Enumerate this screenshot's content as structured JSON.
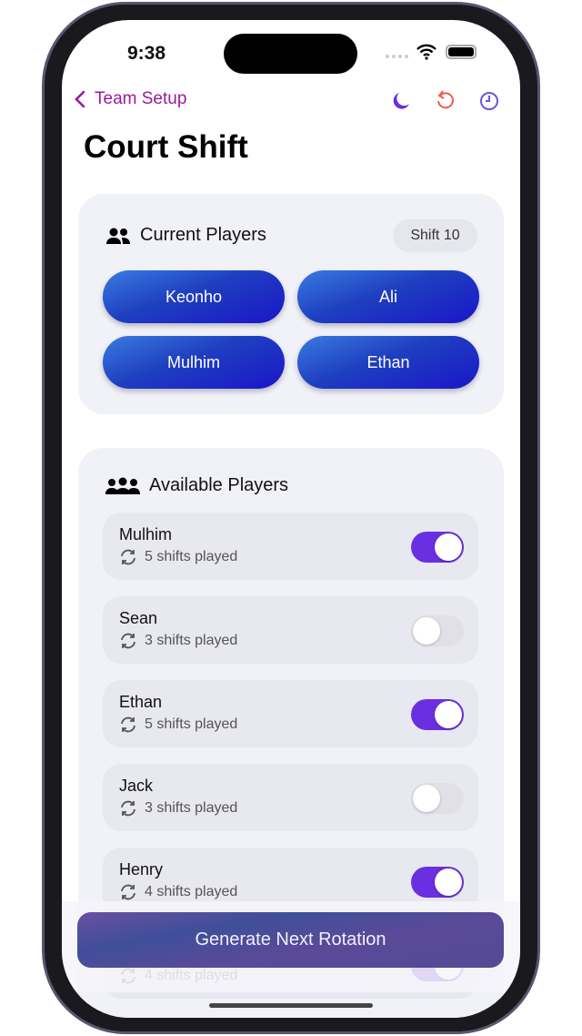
{
  "status": {
    "time": "9:38"
  },
  "nav": {
    "back_label": "Team Setup",
    "icons": [
      "moon-icon",
      "reset-icon",
      "history-icon"
    ],
    "colors": {
      "back": "#9b1a9b",
      "moon": "#6a2fe0",
      "reset": "#f25c4a",
      "history": "#6a55e0"
    }
  },
  "title": "Court Shift",
  "current": {
    "title": "Current Players",
    "shift": "Shift 10",
    "players": [
      "Keonho",
      "Ali",
      "Mulhim",
      "Ethan"
    ]
  },
  "available": {
    "title": "Available Players",
    "players": [
      {
        "name": "Mulhim",
        "shifts": "5 shifts played",
        "on": true
      },
      {
        "name": "Sean",
        "shifts": "3 shifts played",
        "on": false
      },
      {
        "name": "Ethan",
        "shifts": "5 shifts played",
        "on": true
      },
      {
        "name": "Jack",
        "shifts": "3 shifts played",
        "on": false
      },
      {
        "name": "Henry",
        "shifts": "4 shifts played",
        "on": true
      },
      {
        "name": "",
        "shifts": "4 shifts played",
        "on": true
      }
    ]
  },
  "action": {
    "label": "Generate Next Rotation"
  }
}
